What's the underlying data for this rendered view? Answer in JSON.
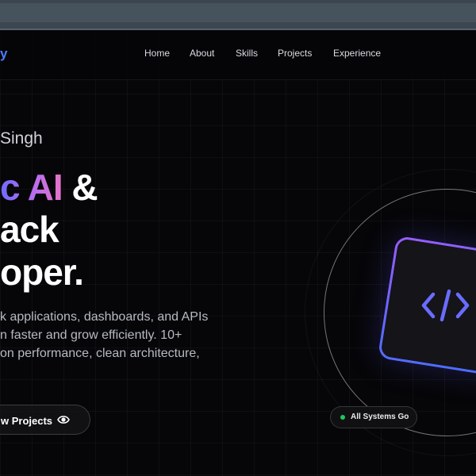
{
  "nav": {
    "logo_fragment": "y",
    "links": [
      "Home",
      "About",
      "Skills",
      "Projects",
      "Experience"
    ]
  },
  "hero": {
    "greeting_fragment": "Singh",
    "headline": {
      "line1_gradient": "c AI",
      "line1_rest": " &",
      "line2": "ack",
      "line3": "oper."
    },
    "description_lines": [
      "k applications, dashboards, and APIs",
      "n faster and grow efficiently. 10+",
      "on performance, clean architecture,"
    ],
    "cta_label": "w Projects",
    "cta_icon": "eye-icon"
  },
  "visual": {
    "card_icon": "code-icon",
    "status_label": "All Systems Go",
    "status_color": "#22c55e"
  },
  "colors": {
    "background": "#060608",
    "accent_blue": "#4f7dff",
    "gradient_start": "#6f6bff",
    "gradient_end": "#e874c8"
  }
}
